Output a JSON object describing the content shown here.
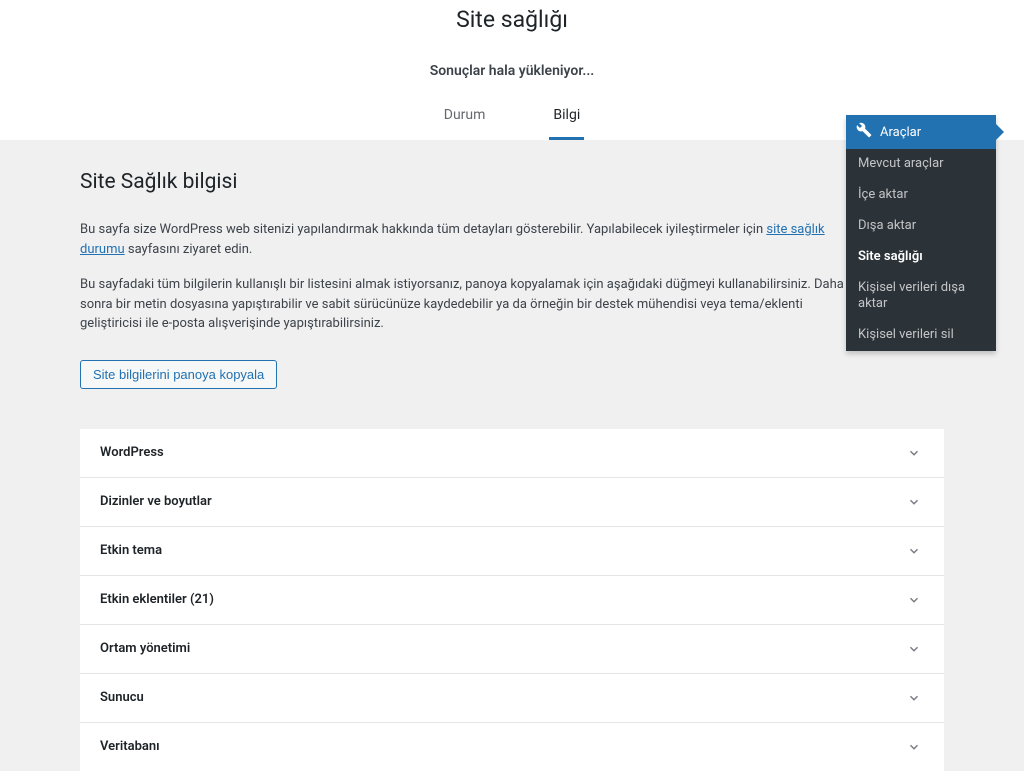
{
  "header": {
    "page_title": "Site sağlığı",
    "loading_text": "Sonuçlar hala yükleniyor...",
    "tabs": {
      "durum": "Durum",
      "bilgi": "Bilgi"
    }
  },
  "content": {
    "section_title": "Site Sağlık bilgisi",
    "para1_pre": "Bu sayfa size WordPress web sitenizi yapılandırmak hakkında tüm detayları gösterebilir. Yapılabilecek iyileştirmeler için ",
    "para1_link": "site sağlık durumu",
    "para1_post": " sayfasını ziyaret edin.",
    "para2": "Bu sayfadaki tüm bilgilerin kullanışlı bir listesini almak istiyorsanız, panoya kopyalamak için aşağıdaki düğmeyi kullanabilirsiniz. Daha sonra bir metin dosyasına yapıştırabilir ve sabit sürücünüze kaydedebilir ya da örneğin bir destek mühendisi veya tema/eklenti geliştiricisi ile e-posta alışverişinde yapıştırabilirsiniz.",
    "copy_button": "Site bilgilerini panoya kopyala"
  },
  "accordion": {
    "items": [
      {
        "label": "WordPress"
      },
      {
        "label": "Dizinler ve boyutlar"
      },
      {
        "label": "Etkin tema"
      },
      {
        "label": "Etkin eklentiler (21)"
      },
      {
        "label": "Ortam yönetimi"
      },
      {
        "label": "Sunucu"
      },
      {
        "label": "Veritabanı"
      }
    ]
  },
  "flyout": {
    "header": "Araçlar",
    "items": [
      {
        "label": "Mevcut araçlar",
        "current": false
      },
      {
        "label": "İçe aktar",
        "current": false
      },
      {
        "label": "Dışa aktar",
        "current": false
      },
      {
        "label": "Site sağlığı",
        "current": true
      },
      {
        "label": "Kişisel verileri dışa aktar",
        "current": false
      },
      {
        "label": "Kişisel verileri sil",
        "current": false
      }
    ]
  }
}
